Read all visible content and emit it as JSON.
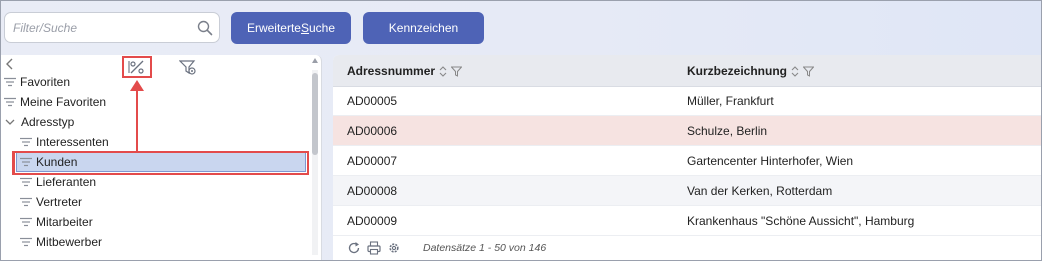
{
  "search": {
    "placeholder": "Filter/Suche"
  },
  "toolbar": {
    "advanced_prefix": "Erweiterte ",
    "advanced_underlined": "S",
    "advanced_suffix": "uche",
    "plate_label": "Kennzeichen"
  },
  "tree": {
    "items": [
      {
        "label": "Favoriten",
        "icon": "lines-icon"
      },
      {
        "label": "Meine Favoriten",
        "icon": "lines-icon"
      },
      {
        "label": "Adresstyp",
        "icon": "chevron-down-icon"
      },
      {
        "label": "Interessenten",
        "icon": "lines-icon"
      },
      {
        "label": "Kunden",
        "icon": "lines-icon",
        "selected": true
      },
      {
        "label": "Lieferanten",
        "icon": "lines-icon"
      },
      {
        "label": "Vertreter",
        "icon": "lines-icon"
      },
      {
        "label": "Mitarbeiter",
        "icon": "lines-icon"
      },
      {
        "label": "Mitbewerber",
        "icon": "lines-icon"
      }
    ]
  },
  "grid": {
    "columns": [
      {
        "label": "Adressnummer"
      },
      {
        "label": "Kurzbezeichnung"
      }
    ],
    "rows": [
      {
        "number": "AD00005",
        "name": "Müller, Frankfurt"
      },
      {
        "number": "AD00006",
        "name": "Schulze, Berlin"
      },
      {
        "number": "AD00007",
        "name": "Gartencenter Hinterhofer, Wien"
      },
      {
        "number": "AD00008",
        "name": "Van der Kerken, Rotterdam"
      },
      {
        "number": "AD00009",
        "name": "Krankenhaus \"Schöne Aussicht\", Hamburg"
      }
    ],
    "footer_text": "Datensätze 1 - 50 von 146"
  },
  "colors": {
    "accent": "#4e63b6",
    "highlight": "#e34b4b",
    "selected_row": "#f6e3e1",
    "tree_selection": "#c9d6ef"
  }
}
